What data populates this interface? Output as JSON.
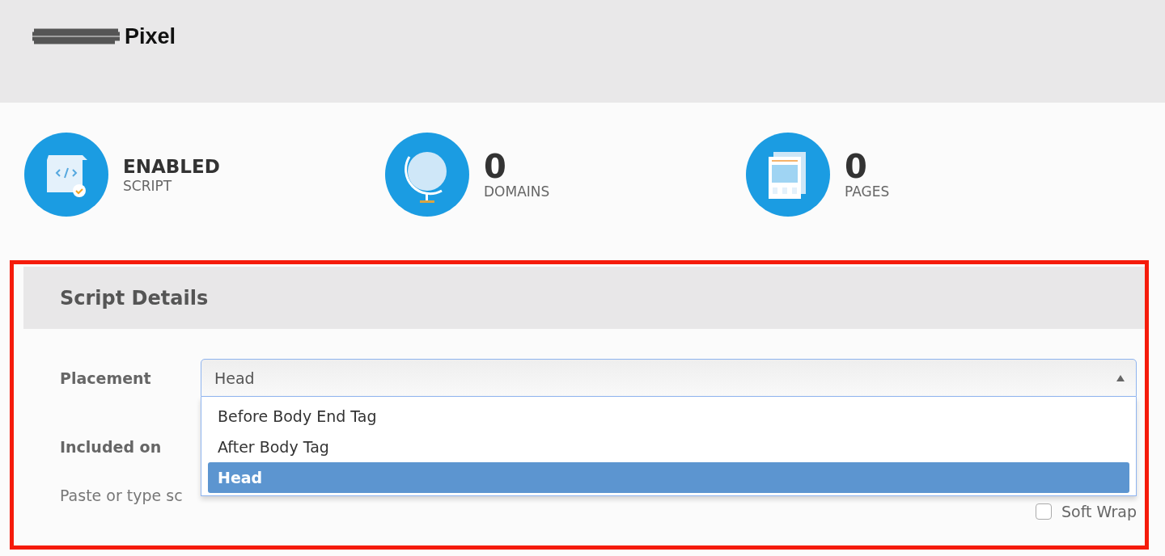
{
  "header": {
    "title": "Pixel"
  },
  "stats": [
    {
      "kind": "script",
      "value": "ENABLED",
      "label": "SCRIPT"
    },
    {
      "kind": "globe",
      "value": "0",
      "label": "DOMAINS"
    },
    {
      "kind": "pages",
      "value": "0",
      "label": "PAGES"
    }
  ],
  "panel": {
    "title": "Script Details",
    "placement": {
      "label": "Placement",
      "value": "Head",
      "expanded": true,
      "options": [
        {
          "label": "Before Body End Tag",
          "selected": false
        },
        {
          "label": "After Body Tag",
          "selected": false
        },
        {
          "label": "Head",
          "selected": true
        }
      ]
    },
    "included_on": {
      "label": "Included on"
    },
    "hint": "Paste or type sc",
    "soft_wrap": {
      "label": "Soft Wrap",
      "checked": false
    }
  }
}
